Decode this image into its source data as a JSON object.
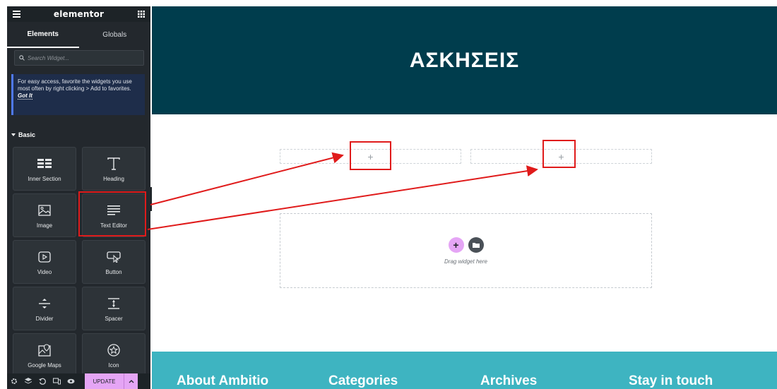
{
  "app": {
    "logo": "elementor"
  },
  "sidebar": {
    "tabs": [
      {
        "label": "Elements",
        "active": true
      },
      {
        "label": "Globals",
        "active": false
      }
    ],
    "search": {
      "placeholder": "Search Widget..."
    },
    "notice": {
      "text": "For easy access, favorite the widgets you use most often by right clicking > Add to favorites.",
      "link": "Got It"
    },
    "category": "Basic",
    "widgets": [
      {
        "label": "Inner Section",
        "icon": "inner-section-icon"
      },
      {
        "label": "Heading",
        "icon": "heading-icon"
      },
      {
        "label": "Image",
        "icon": "image-icon"
      },
      {
        "label": "Text Editor",
        "icon": "text-editor-icon"
      },
      {
        "label": "Video",
        "icon": "video-icon"
      },
      {
        "label": "Button",
        "icon": "button-icon"
      },
      {
        "label": "Divider",
        "icon": "divider-icon"
      },
      {
        "label": "Spacer",
        "icon": "spacer-icon"
      },
      {
        "label": "Google Maps",
        "icon": "google-maps-icon"
      },
      {
        "label": "Icon",
        "icon": "star-icon"
      }
    ],
    "footer": {
      "update_label": "UPDATE"
    }
  },
  "canvas": {
    "hero_title": "ΑΣΚΗΣΕΙΣ",
    "drop_zone_text": "Drag widget here",
    "footer_columns": [
      "About Ambitio",
      "Categories",
      "Archives",
      "Stay in touch"
    ]
  },
  "colors": {
    "sidebar_bg": "#23282d",
    "hero_bg": "#003d4d",
    "footer_bg": "#3eb4c1",
    "accent_pink": "#e5a5f5",
    "annotation_red": "#e01b1b"
  }
}
